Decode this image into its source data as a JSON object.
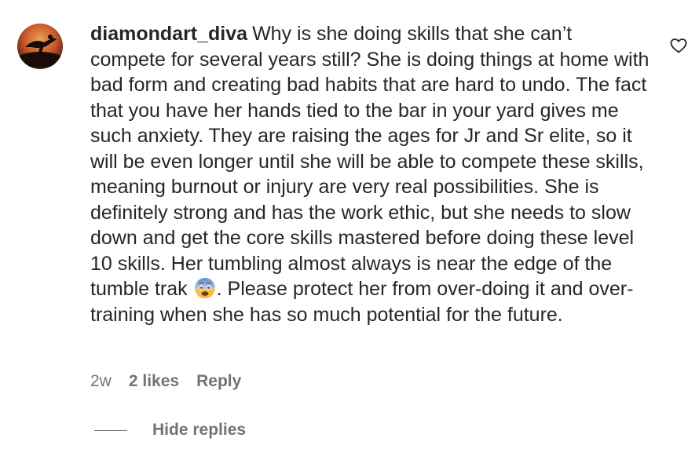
{
  "comment": {
    "username": "diamondart_diva",
    "text_before_emoji": "Why is she doing skills that she can’t compete for several years still? She is doing things at home with bad form and creating bad habits that are hard to undo. The fact that you have her hands tied to the bar in your yard gives me such anxiety. They are raising the ages for Jr and Sr elite, so it will be even longer until she will be able to compete these skills, meaning burnout or injury are very real possibilities. She is definitely strong and has the work ethic, but she needs to slow down and get the core skills mastered before doing these level 10 skills. Her tumbling almost always is near the edge of the tumble trak",
    "emoji": "fearful-face-emoji",
    "text_after_emoji": ". Please protect her from over-doing it and over-training when she has so much potential for the future.",
    "time_ago": "2w",
    "likes": "2 likes",
    "reply_label": "Reply",
    "hide_replies_label": "Hide replies",
    "like_icon": "heart-outline-icon"
  },
  "colors": {
    "text": "#262626",
    "secondary": "#737373"
  }
}
